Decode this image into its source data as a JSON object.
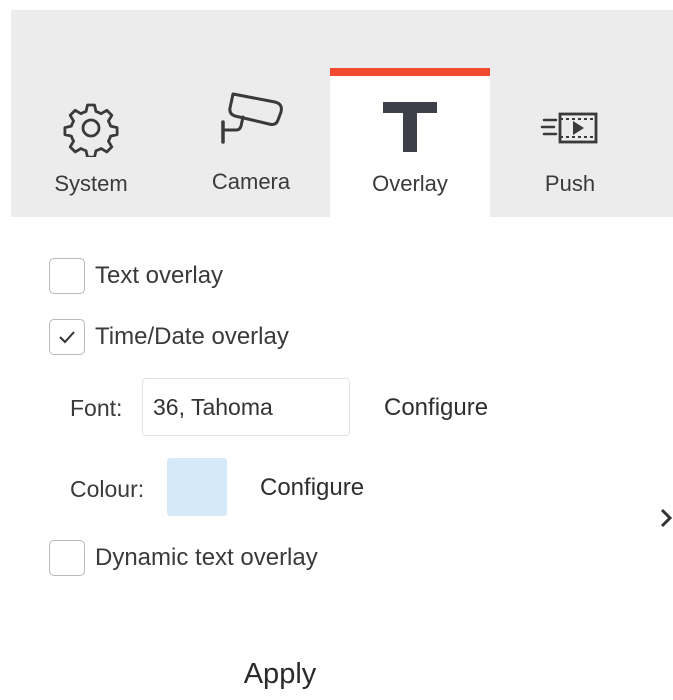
{
  "tabs": [
    {
      "label": "System",
      "icon": "gear-icon",
      "active": false
    },
    {
      "label": "Camera",
      "icon": "camera-icon",
      "active": false
    },
    {
      "label": "Overlay",
      "icon": "text-t-icon",
      "active": true
    },
    {
      "label": "Push",
      "icon": "push-video-icon",
      "active": false
    }
  ],
  "options": {
    "text_overlay": {
      "label": "Text overlay",
      "checked": false
    },
    "time_date_overlay": {
      "label": "Time/Date overlay",
      "checked": true
    },
    "dynamic_text_overlay": {
      "label": "Dynamic text overlay",
      "checked": false
    }
  },
  "font": {
    "label": "Font:",
    "value": "36, Tahoma",
    "configure_label": "Configure"
  },
  "colour": {
    "label": "Colour:",
    "swatch_color": "#d6e9f8",
    "configure_label": "Configure"
  },
  "apply_label": "Apply",
  "colors": {
    "accent": "#f24a2c",
    "tabbar_bg": "#ececec"
  }
}
